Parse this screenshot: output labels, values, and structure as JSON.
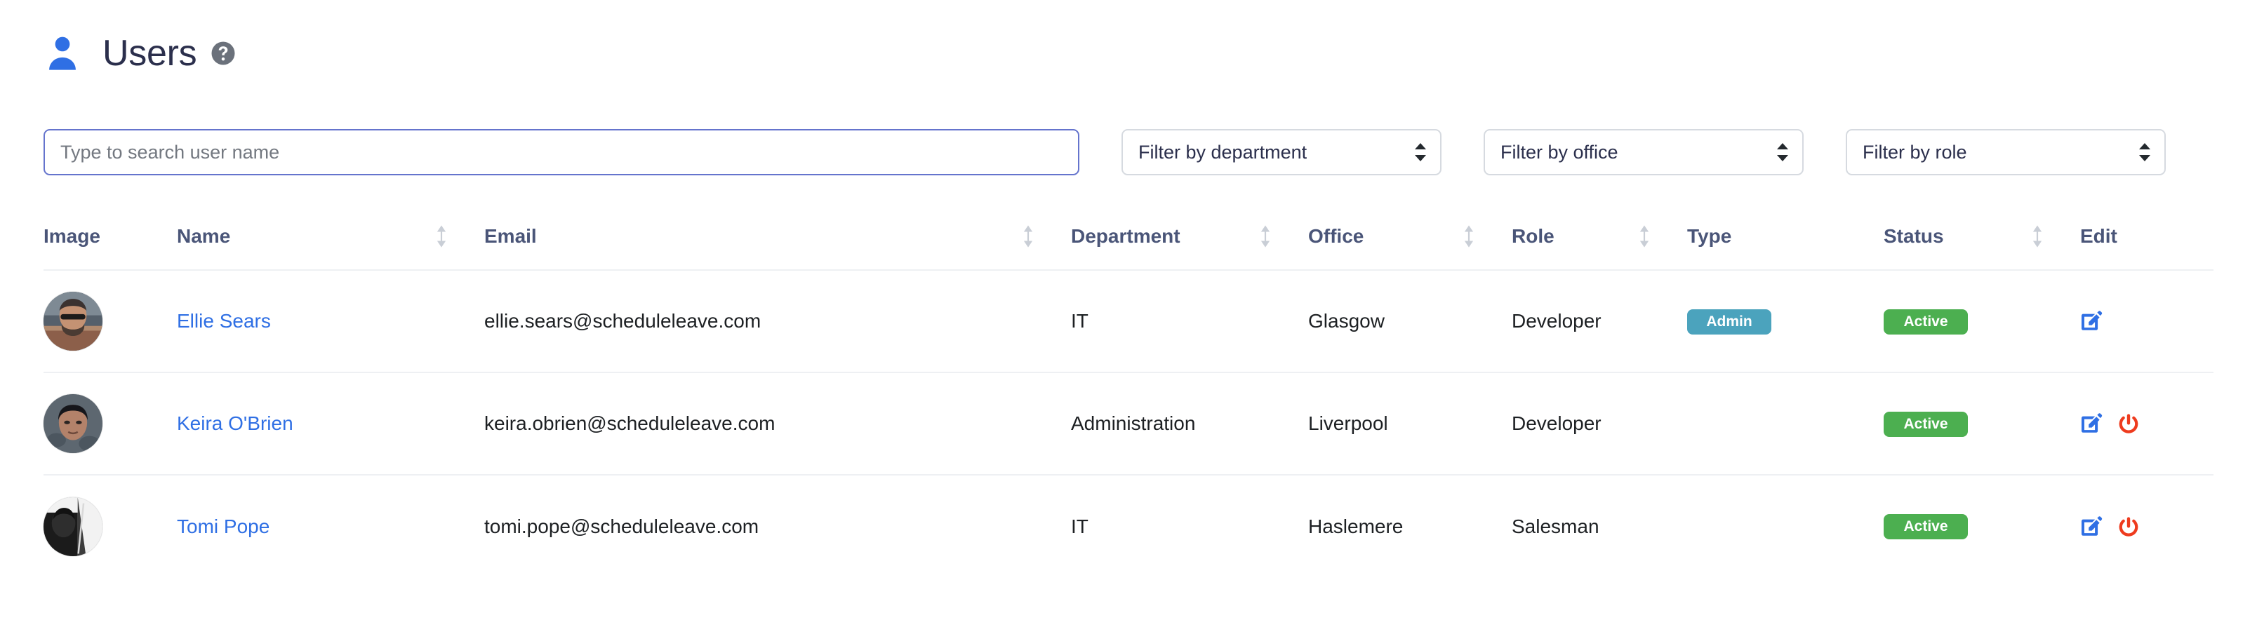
{
  "header": {
    "title": "Users",
    "person_icon": "person-icon",
    "help_icon": "help-circle-icon"
  },
  "filters": {
    "search": {
      "placeholder": "Type to search user name",
      "value": ""
    },
    "department": {
      "selected": "Filter by department"
    },
    "office": {
      "selected": "Filter by office"
    },
    "role": {
      "selected": "Filter by role"
    }
  },
  "table": {
    "columns": [
      {
        "label": "Image",
        "sortable": false
      },
      {
        "label": "Name",
        "sortable": true
      },
      {
        "label": "Email",
        "sortable": true
      },
      {
        "label": "Department",
        "sortable": true
      },
      {
        "label": "Office",
        "sortable": true
      },
      {
        "label": "Role",
        "sortable": true
      },
      {
        "label": "Type",
        "sortable": false
      },
      {
        "label": "Status",
        "sortable": true
      },
      {
        "label": "Edit",
        "sortable": false
      }
    ],
    "rows": [
      {
        "name": "Ellie Sears",
        "email": "ellie.sears@scheduleleave.com",
        "department": "IT",
        "office": "Glasgow",
        "role": "Developer",
        "type": "Admin",
        "status": "Active",
        "actions": [
          "edit-icon"
        ]
      },
      {
        "name": "Keira O'Brien",
        "email": "keira.obrien@scheduleleave.com",
        "department": "Administration",
        "office": "Liverpool",
        "role": "Developer",
        "type": "",
        "status": "Active",
        "actions": [
          "edit-icon",
          "power-icon"
        ]
      },
      {
        "name": "Tomi Pope",
        "email": "tomi.pope@scheduleleave.com",
        "department": "IT",
        "office": "Haslemere",
        "role": "Salesman",
        "type": "",
        "status": "Active",
        "actions": [
          "edit-icon",
          "power-icon"
        ]
      }
    ]
  },
  "colors": {
    "brand_blue": "#2f6fe4",
    "title_navy": "#2b2f4c",
    "header_text": "#4a5578",
    "focus_border": "#6574cd",
    "badge_admin": "#4ba3bd",
    "badge_active": "#4caf50",
    "edit_icon": "#2f6fe4",
    "power_icon": "#ee3b1e",
    "help_icon": "#6b717b"
  }
}
